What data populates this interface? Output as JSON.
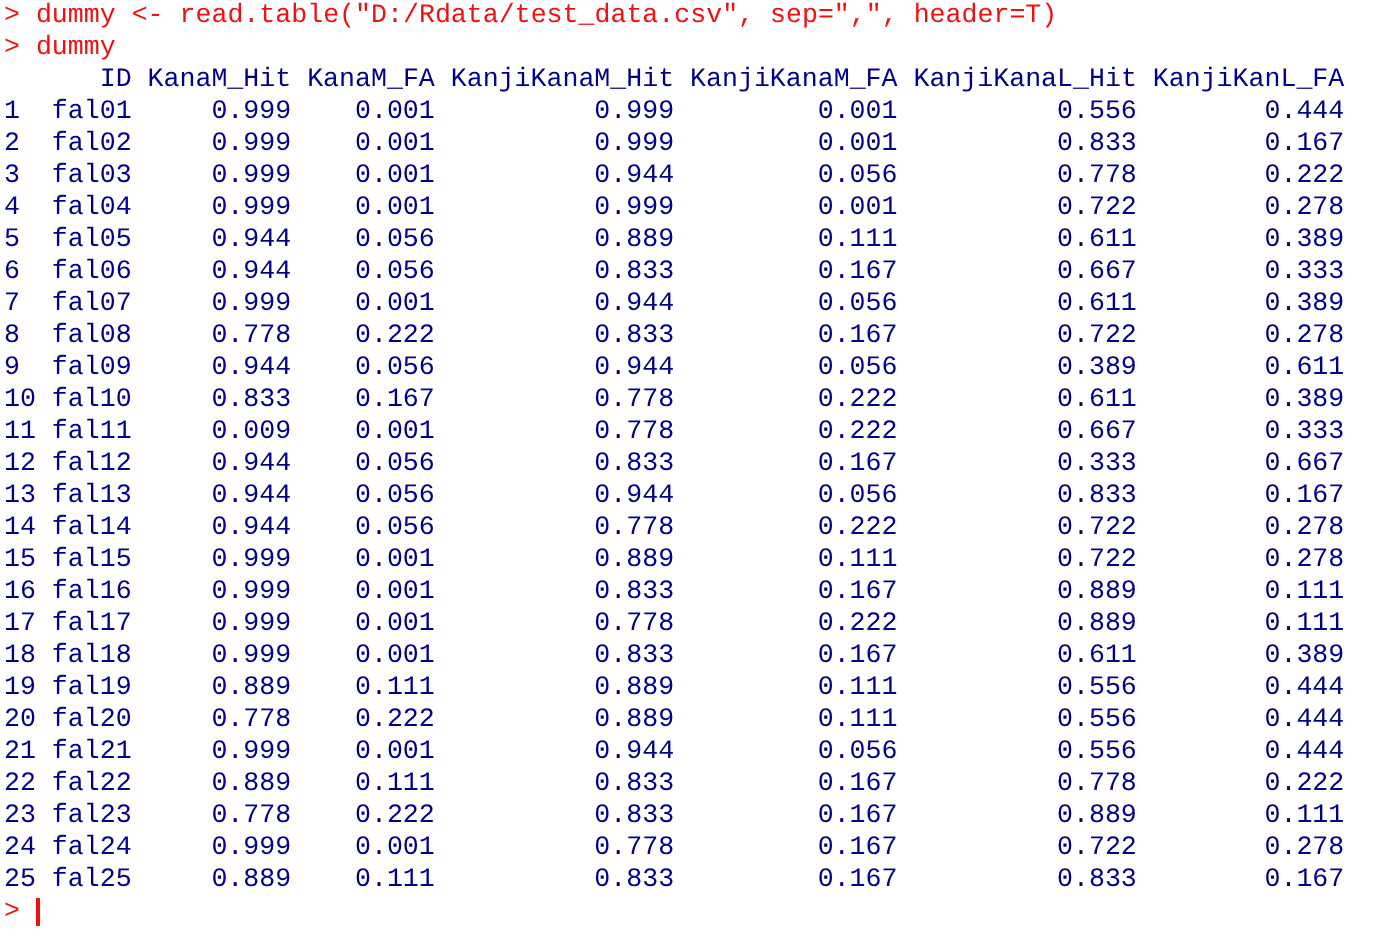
{
  "console": {
    "commands": [
      {
        "prompt": ">",
        "text": "dummy <- read.table(\"D:/Rdata/test_data.csv\", sep=\",\", header=T)"
      },
      {
        "prompt": ">",
        "text": "dummy"
      }
    ],
    "table": {
      "columns": [
        "ID",
        "KanaM_Hit",
        "KanaM_FA",
        "KanjiKanaM_Hit",
        "KanjiKanaM_FA",
        "KanjiKanaL_Hit",
        "KanjiKanL_FA"
      ],
      "rows": [
        {
          "row_name": "1",
          "cells": [
            "fal01",
            "0.999",
            "0.001",
            "0.999",
            "0.001",
            "0.556",
            "0.444"
          ]
        },
        {
          "row_name": "2",
          "cells": [
            "fal02",
            "0.999",
            "0.001",
            "0.999",
            "0.001",
            "0.833",
            "0.167"
          ]
        },
        {
          "row_name": "3",
          "cells": [
            "fal03",
            "0.999",
            "0.001",
            "0.944",
            "0.056",
            "0.778",
            "0.222"
          ]
        },
        {
          "row_name": "4",
          "cells": [
            "fal04",
            "0.999",
            "0.001",
            "0.999",
            "0.001",
            "0.722",
            "0.278"
          ]
        },
        {
          "row_name": "5",
          "cells": [
            "fal05",
            "0.944",
            "0.056",
            "0.889",
            "0.111",
            "0.611",
            "0.389"
          ]
        },
        {
          "row_name": "6",
          "cells": [
            "fal06",
            "0.944",
            "0.056",
            "0.833",
            "0.167",
            "0.667",
            "0.333"
          ]
        },
        {
          "row_name": "7",
          "cells": [
            "fal07",
            "0.999",
            "0.001",
            "0.944",
            "0.056",
            "0.611",
            "0.389"
          ]
        },
        {
          "row_name": "8",
          "cells": [
            "fal08",
            "0.778",
            "0.222",
            "0.833",
            "0.167",
            "0.722",
            "0.278"
          ]
        },
        {
          "row_name": "9",
          "cells": [
            "fal09",
            "0.944",
            "0.056",
            "0.944",
            "0.056",
            "0.389",
            "0.611"
          ]
        },
        {
          "row_name": "10",
          "cells": [
            "fal10",
            "0.833",
            "0.167",
            "0.778",
            "0.222",
            "0.611",
            "0.389"
          ]
        },
        {
          "row_name": "11",
          "cells": [
            "fal11",
            "0.009",
            "0.001",
            "0.778",
            "0.222",
            "0.667",
            "0.333"
          ]
        },
        {
          "row_name": "12",
          "cells": [
            "fal12",
            "0.944",
            "0.056",
            "0.833",
            "0.167",
            "0.333",
            "0.667"
          ]
        },
        {
          "row_name": "13",
          "cells": [
            "fal13",
            "0.944",
            "0.056",
            "0.944",
            "0.056",
            "0.833",
            "0.167"
          ]
        },
        {
          "row_name": "14",
          "cells": [
            "fal14",
            "0.944",
            "0.056",
            "0.778",
            "0.222",
            "0.722",
            "0.278"
          ]
        },
        {
          "row_name": "15",
          "cells": [
            "fal15",
            "0.999",
            "0.001",
            "0.889",
            "0.111",
            "0.722",
            "0.278"
          ]
        },
        {
          "row_name": "16",
          "cells": [
            "fal16",
            "0.999",
            "0.001",
            "0.833",
            "0.167",
            "0.889",
            "0.111"
          ]
        },
        {
          "row_name": "17",
          "cells": [
            "fal17",
            "0.999",
            "0.001",
            "0.778",
            "0.222",
            "0.889",
            "0.111"
          ]
        },
        {
          "row_name": "18",
          "cells": [
            "fal18",
            "0.999",
            "0.001",
            "0.833",
            "0.167",
            "0.611",
            "0.389"
          ]
        },
        {
          "row_name": "19",
          "cells": [
            "fal19",
            "0.889",
            "0.111",
            "0.889",
            "0.111",
            "0.556",
            "0.444"
          ]
        },
        {
          "row_name": "20",
          "cells": [
            "fal20",
            "0.778",
            "0.222",
            "0.889",
            "0.111",
            "0.556",
            "0.444"
          ]
        },
        {
          "row_name": "21",
          "cells": [
            "fal21",
            "0.999",
            "0.001",
            "0.944",
            "0.056",
            "0.556",
            "0.444"
          ]
        },
        {
          "row_name": "22",
          "cells": [
            "fal22",
            "0.889",
            "0.111",
            "0.833",
            "0.167",
            "0.778",
            "0.222"
          ]
        },
        {
          "row_name": "23",
          "cells": [
            "fal23",
            "0.778",
            "0.222",
            "0.833",
            "0.167",
            "0.889",
            "0.111"
          ]
        },
        {
          "row_name": "24",
          "cells": [
            "fal24",
            "0.999",
            "0.001",
            "0.778",
            "0.167",
            "0.722",
            "0.278"
          ]
        },
        {
          "row_name": "25",
          "cells": [
            "fal25",
            "0.889",
            "0.111",
            "0.833",
            "0.167",
            "0.833",
            "0.167"
          ]
        }
      ]
    },
    "input_prompt": ">"
  }
}
